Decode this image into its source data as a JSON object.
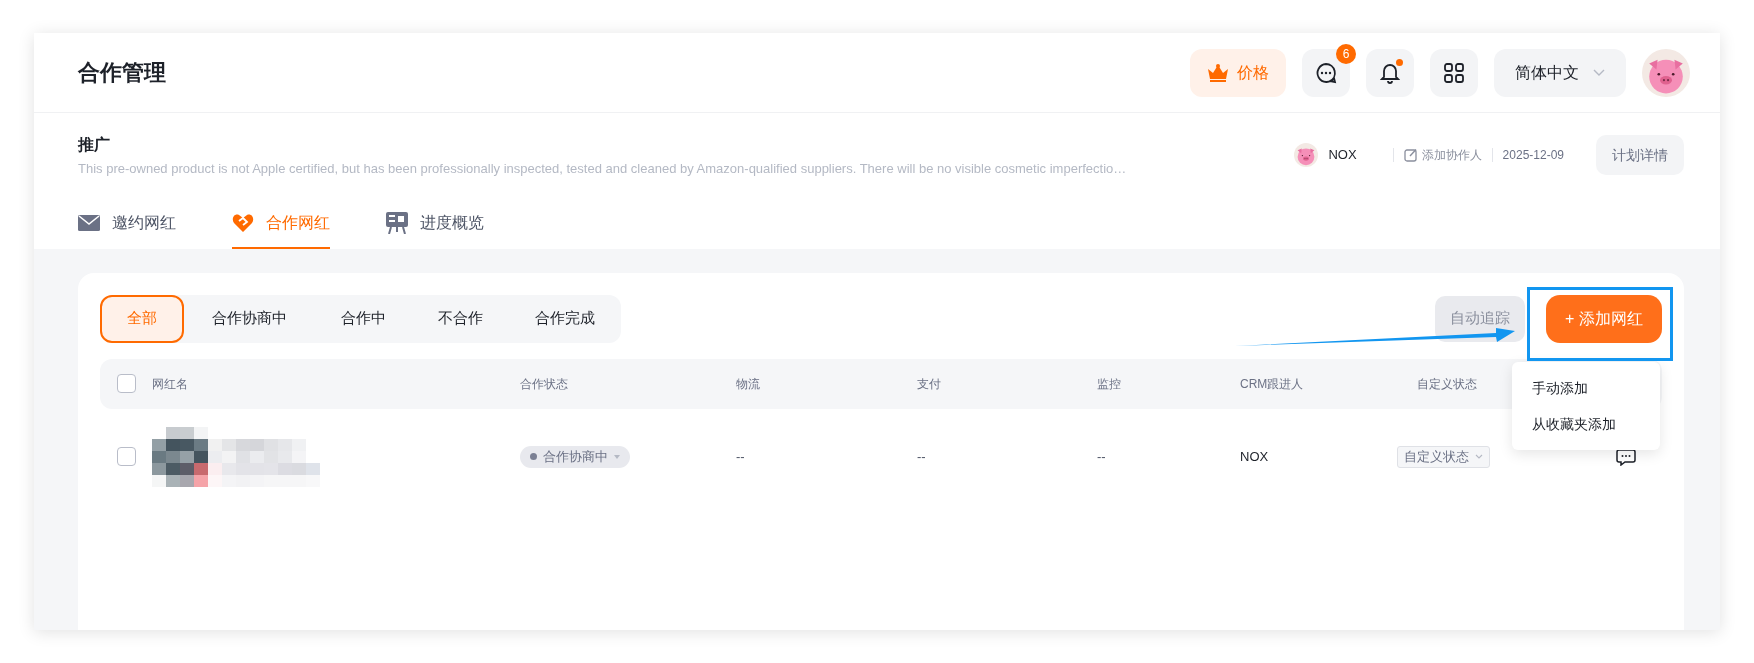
{
  "header": {
    "title": "合作管理",
    "price_button": "价格",
    "message_badge": "6",
    "notification_dot": true,
    "language": "简体中文"
  },
  "plan": {
    "title": "推广",
    "description": "This pre-owned product is not Apple certified, but has been professionally inspected, tested and cleaned by Amazon-qualified suppliers. There will be no visible cosmetic imperfectio…",
    "owner": "NOX",
    "add_collaborator": "添加协作人",
    "date": "2025-12-09",
    "details_button": "计划详情"
  },
  "tabs": [
    {
      "label": "邀约网红",
      "selected": false
    },
    {
      "label": "合作网红",
      "selected": true
    },
    {
      "label": "进度概览",
      "selected": false
    }
  ],
  "filters": [
    {
      "label": "全部",
      "selected": true
    },
    {
      "label": "合作协商中",
      "selected": false
    },
    {
      "label": "合作中",
      "selected": false
    },
    {
      "label": "不合作",
      "selected": false
    },
    {
      "label": "合作完成",
      "selected": false
    }
  ],
  "auto_track_button": "自动追踪",
  "add_button": "+ 添加网红",
  "add_menu": [
    "手动添加",
    "从收藏夹添加"
  ],
  "table": {
    "columns": [
      "网红名",
      "合作状态",
      "物流",
      "支付",
      "监控",
      "CRM跟进人",
      "自定义状态"
    ],
    "all_checked": false,
    "rows": [
      {
        "checked": false,
        "status": "合作协商中",
        "logistics": "--",
        "payment": "--",
        "monitoring": "--",
        "crm": "NOX",
        "custom_status": "自定义状态"
      }
    ]
  }
}
